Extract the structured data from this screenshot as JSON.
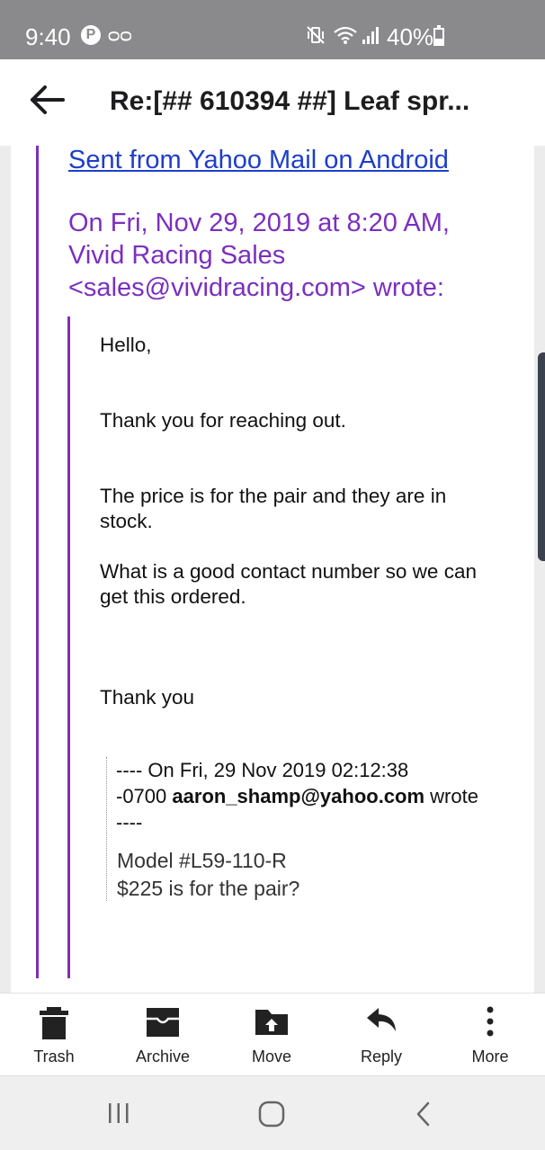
{
  "status_bar": {
    "time": "9:40",
    "battery": "40%",
    "icons": [
      "pinterest-icon",
      "voicemail-icon",
      "mute-vibrate-icon",
      "wifi-icon",
      "signal-icon",
      "battery-icon"
    ]
  },
  "header": {
    "title": "Re:[## 610394 ##]  Leaf spr..."
  },
  "email": {
    "sent_from_link": "Sent from Yahoo Mail on Android",
    "wrote_header": {
      "line1": "On Fri, Nov 29, 2019 at 8:20 AM,",
      "line2": "Vivid Racing Sales",
      "line3": "<sales@vividracing.com> wrote:"
    },
    "reply": {
      "greeting": "Hello,",
      "thanks": "Thank you for reaching out.",
      "price_line1": "The price is for the pair and they are in",
      "price_line2": "stock.",
      "contact_line1": "What is a good contact number so we can",
      "contact_line2": "get this ordered.",
      "closing": "Thank you"
    },
    "original": {
      "header_line1": "---- On Fri, 29 Nov 2019 02:12:38",
      "header_prefix": "-0700",
      "sender": "aaron_shamp@yahoo.com",
      "header_suffix": "wrote",
      "header_line3": "----",
      "model_line": "Model #L59-110-R",
      "question_line": "$225 is for the pair?"
    }
  },
  "toolbar": {
    "trash": "Trash",
    "archive": "Archive",
    "move": "Move",
    "reply": "Reply",
    "more": "More"
  },
  "colors": {
    "quote_purple": "#7b2fbf",
    "link_blue": "#1e3ec9",
    "status_bar_gray": "#8a8a8c"
  }
}
